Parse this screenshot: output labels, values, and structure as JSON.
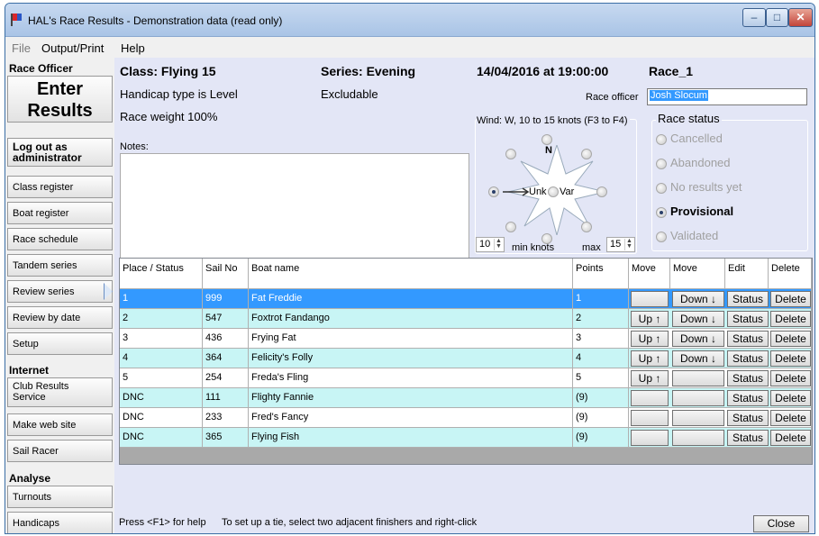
{
  "window": {
    "title": "HAL's Race Results - Demonstration data (read only)"
  },
  "menu": {
    "file": "File",
    "output_print": "Output/Print",
    "help": "Help"
  },
  "sidebar": {
    "race_officer_heading": "Race Officer",
    "enter_results_1": "Enter",
    "enter_results_2": "Results",
    "logout_1": "Log out as",
    "logout_2": "administrator",
    "class_register": "Class register",
    "boat_register": "Boat register",
    "race_schedule": "Race schedule",
    "tandem_series": "Tandem series",
    "review_series": "Review series",
    "review_by_date": "Review by date",
    "setup": "Setup",
    "internet_heading": "Internet",
    "club_results_1": "Club Results",
    "club_results_2": "Service",
    "make_web_site": "Make web site",
    "sail_racer": "Sail Racer",
    "analyse_heading": "Analyse",
    "turnouts": "Turnouts",
    "handicaps": "Handicaps"
  },
  "header": {
    "class": "Class: Flying 15",
    "series": "Series: Evening",
    "datetime": "14/04/2016 at 19:00:00",
    "race": "Race_1",
    "handicap_type": "Handicap type is Level",
    "excludable": "Excludable",
    "race_officer_label": "Race officer",
    "race_officer_value": "Josh Slocum",
    "race_weight": "Race weight 100%",
    "notes_label": "Notes:"
  },
  "wind": {
    "label": "Wind: W, 10 to 15 knots (F3 to F4)",
    "north": "N",
    "unk": "Unk",
    "var": "Var",
    "min_value": "10",
    "min_label": "min knots",
    "max_label": "max",
    "max_value": "15"
  },
  "race_status": {
    "label": "Race status",
    "options": [
      "Cancelled",
      "Abandoned",
      "No results yet",
      "Provisional",
      "Validated"
    ],
    "selected": "Provisional"
  },
  "table": {
    "headers": [
      "Place / Status",
      "Sail No",
      "Boat name",
      "Points",
      "Move",
      "Move",
      "Edit",
      "Delete"
    ],
    "rows": [
      {
        "place": "1",
        "sail": "999",
        "boat": "Fat Freddie",
        "points": "1",
        "up": "",
        "down": "Down ↓",
        "status": "Status",
        "delete": "Delete"
      },
      {
        "place": "2",
        "sail": "547",
        "boat": "Foxtrot Fandango",
        "points": "2",
        "up": "Up ↑",
        "down": "Down ↓",
        "status": "Status",
        "delete": "Delete"
      },
      {
        "place": "3",
        "sail": "436",
        "boat": "Frying Fat",
        "points": "3",
        "up": "Up ↑",
        "down": "Down ↓",
        "status": "Status",
        "delete": "Delete"
      },
      {
        "place": "4",
        "sail": "364",
        "boat": "Felicity's Folly",
        "points": "4",
        "up": "Up ↑",
        "down": "Down ↓",
        "status": "Status",
        "delete": "Delete"
      },
      {
        "place": "5",
        "sail": "254",
        "boat": "Freda's Fling",
        "points": "5",
        "up": "Up ↑",
        "down": "",
        "status": "Status",
        "delete": "Delete"
      },
      {
        "place": "DNC",
        "sail": "111",
        "boat": "Flighty Fannie",
        "points": "(9)",
        "up": "",
        "down": "",
        "status": "Status",
        "delete": "Delete"
      },
      {
        "place": "DNC",
        "sail": "233",
        "boat": "Fred's Fancy",
        "points": "(9)",
        "up": "",
        "down": "",
        "status": "Status",
        "delete": "Delete"
      },
      {
        "place": "DNC",
        "sail": "365",
        "boat": "Flying Fish",
        "points": "(9)",
        "up": "",
        "down": "",
        "status": "Status",
        "delete": "Delete"
      }
    ]
  },
  "statusbar": {
    "help": "Press <F1> for help",
    "tip": "To set up a tie, select two adjacent finishers and right-click",
    "close": "Close"
  },
  "colors": {
    "selected_row": "#3399ff",
    "alt_row": "#c8f5f5",
    "panel": "#e3e6f6"
  }
}
